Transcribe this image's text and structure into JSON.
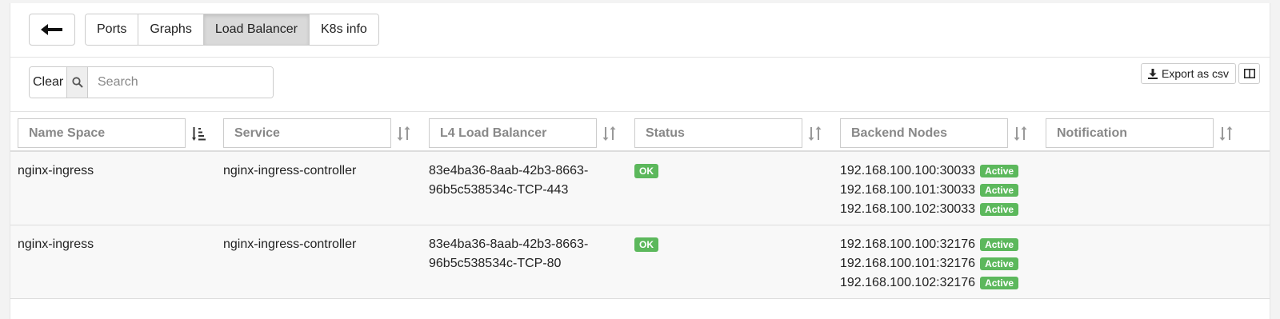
{
  "nav": {
    "back_icon": "arrow-left-icon",
    "tabs": [
      {
        "label": "Ports",
        "active": false
      },
      {
        "label": "Graphs",
        "active": false
      },
      {
        "label": "Load Balancer",
        "active": true
      },
      {
        "label": "K8s info",
        "active": false
      }
    ]
  },
  "toolbar": {
    "clear_label": "Clear",
    "search_icon": "search-icon",
    "search_placeholder": "Search",
    "search_value": "",
    "export_label": "Export as csv",
    "export_icon": "download-icon",
    "columns_icon": "columns-icon"
  },
  "table": {
    "columns": [
      {
        "label": "Name Space",
        "sort": "sorted-ascending"
      },
      {
        "label": "Service",
        "sort": "unsorted"
      },
      {
        "label": "L4 Load Balancer",
        "sort": "unsorted"
      },
      {
        "label": "Status",
        "sort": "unsorted"
      },
      {
        "label": "Backend Nodes",
        "sort": "unsorted"
      },
      {
        "label": "Notification",
        "sort": "unsorted"
      }
    ],
    "rows": [
      {
        "namespace": "nginx-ingress",
        "service": "nginx-ingress-controller",
        "lb_line1": "83e4ba36-8aab-42b3-8663-",
        "lb_line2": "96b5c538534c-TCP-443",
        "status": "OK",
        "nodes": [
          {
            "addr": "192.168.100.100:30033",
            "state": "Active"
          },
          {
            "addr": "192.168.100.101:30033",
            "state": "Active"
          },
          {
            "addr": "192.168.100.102:30033",
            "state": "Active"
          }
        ],
        "notification": ""
      },
      {
        "namespace": "nginx-ingress",
        "service": "nginx-ingress-controller",
        "lb_line1": "83e4ba36-8aab-42b3-8663-",
        "lb_line2": "96b5c538534c-TCP-80",
        "status": "OK",
        "nodes": [
          {
            "addr": "192.168.100.100:32176",
            "state": "Active"
          },
          {
            "addr": "192.168.100.101:32176",
            "state": "Active"
          },
          {
            "addr": "192.168.100.102:32176",
            "state": "Active"
          }
        ],
        "notification": ""
      }
    ]
  },
  "colors": {
    "badge_green": "#5cb85c",
    "active_tab_bg": "#d9d9d9"
  }
}
